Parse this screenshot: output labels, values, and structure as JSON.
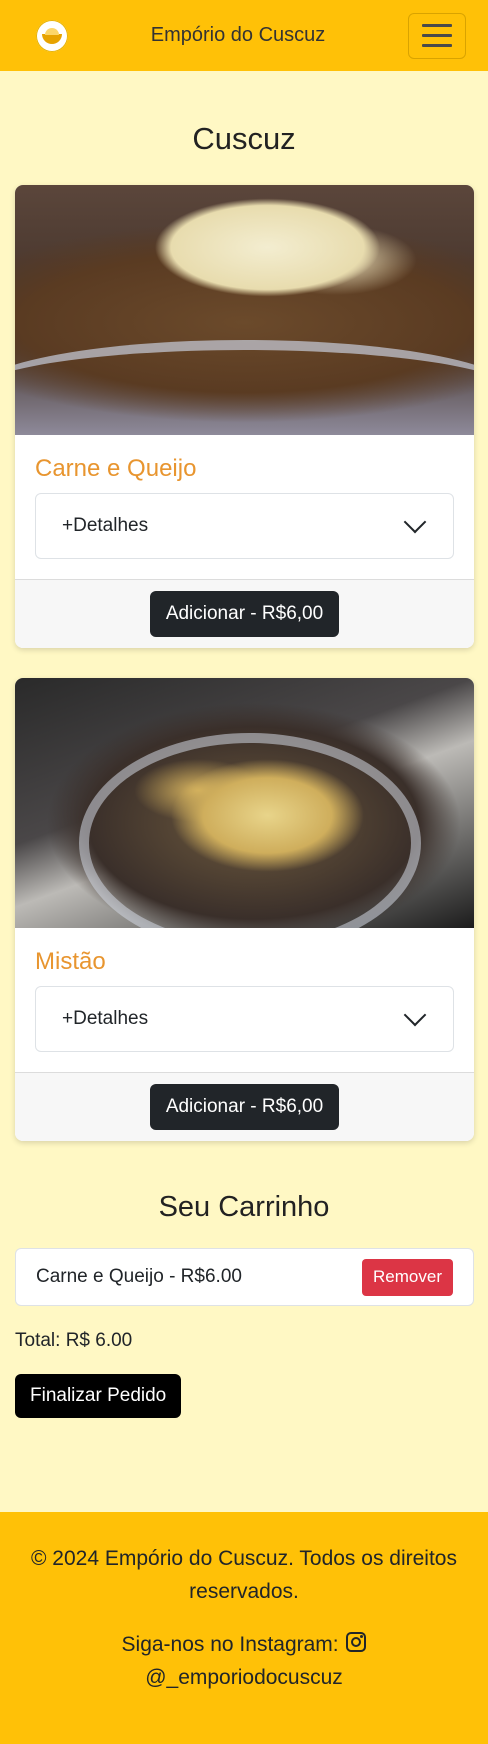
{
  "navbar": {
    "brand": "Empório do Cuscuz",
    "logo_icon": "cuscuz-bowl-logo",
    "menu_icon": "hamburger-menu-icon"
  },
  "menu": {
    "title": "Cuscuz",
    "products": [
      {
        "name": "Carne e Queijo",
        "details_label": "+Detalhes",
        "add_label": "Adicionar - R$6,00",
        "image": "cuscuz-carne-queijo-photo"
      },
      {
        "name": "Mistão",
        "details_label": "+Detalhes",
        "add_label": "Adicionar - R$6,00",
        "image": "cuscuz-mistao-photo"
      }
    ]
  },
  "cart": {
    "title": "Seu Carrinho",
    "items": [
      {
        "label": "Carne e Queijo - R$6.00",
        "remove_label": "Remover"
      }
    ],
    "total": "Total: R$ 6.00",
    "checkout_label": "Finalizar Pedido"
  },
  "footer": {
    "copyright": "© 2024 Empório do Cuscuz. Todos os direitos reservados.",
    "instagram_prefix": "Siga-nos no Instagram:",
    "instagram_handle": "@_emporiodocuscuz",
    "instagram_icon": "instagram-icon"
  },
  "colors": {
    "primary": "#ffc107",
    "background": "#fff8c4",
    "product_title": "#e8952f",
    "danger": "#dc3545",
    "dark": "#212529"
  }
}
